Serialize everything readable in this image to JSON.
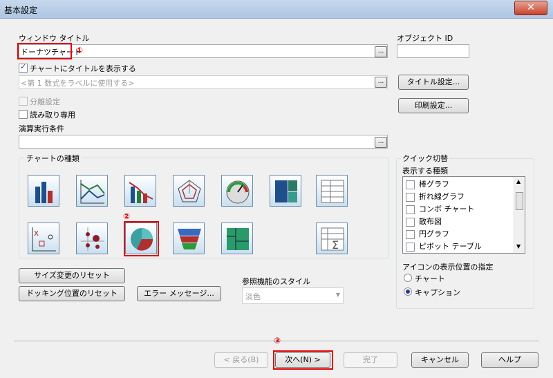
{
  "window": {
    "title": "基本設定",
    "close_icon": "close-icon"
  },
  "window_title": {
    "label": "ウィンドウ タイトル",
    "value": "ドーナツチャート",
    "marker": "①",
    "dots": "..."
  },
  "object_id": {
    "label": "オブジェクト ID",
    "value": ""
  },
  "show_title": {
    "label": "チャートにタイトルを表示する",
    "checked": true
  },
  "title_expr": {
    "placeholder": "<第 1 数式をラベルに使用する>",
    "dots": "..."
  },
  "title_settings_button": "タイトル設定...",
  "print_settings_button": "印刷設定...",
  "detach": {
    "label": "分離設定",
    "checked": false
  },
  "readonly": {
    "label": "読み取り専用",
    "checked": false
  },
  "calc_condition": {
    "label": "演算実行条件",
    "value": "",
    "dots": "..."
  },
  "chart_types": {
    "label": "チャートの種類",
    "selected_marker": "②",
    "selected": "pie",
    "icons": [
      "bar-chart-icon",
      "line-chart-icon",
      "combo-chart-icon",
      "radar-chart-icon",
      "gauge-chart-icon",
      "block-chart-icon",
      "straight-table-icon",
      "scatter-chart-icon",
      "grid-chart-icon",
      "pie-chart-icon",
      "funnel-chart-icon",
      "mekko-chart-icon",
      "pivot-table-icon"
    ]
  },
  "quick_switch": {
    "label": "クイック切替",
    "types_label": "表示する種類",
    "items": [
      "棒グラフ",
      "折れ線グラフ",
      "コンボ チャート",
      "散布図",
      "円グラフ",
      "ピボット テーブル"
    ]
  },
  "icon_position": {
    "label": "アイコンの表示位置の指定",
    "options": [
      "チャート",
      "キャプション"
    ],
    "selected": "キャプション"
  },
  "reset_size_button": "サイズ変更のリセット",
  "reset_docking_button": "ドッキング位置のリセット",
  "error_message_button": "エラー メッセージ...",
  "lookup_style": {
    "label": "参照機能のスタイル",
    "value": "淡色"
  },
  "footer": {
    "back_button": "< 戻る(B)",
    "next_button": "次へ(N) >",
    "next_marker": "③",
    "finish_button": "完了",
    "cancel_button": "キャンセル",
    "help_button": "ヘルプ"
  },
  "colors": {
    "highlight": "#e00000",
    "accent": "#1c3f94"
  }
}
